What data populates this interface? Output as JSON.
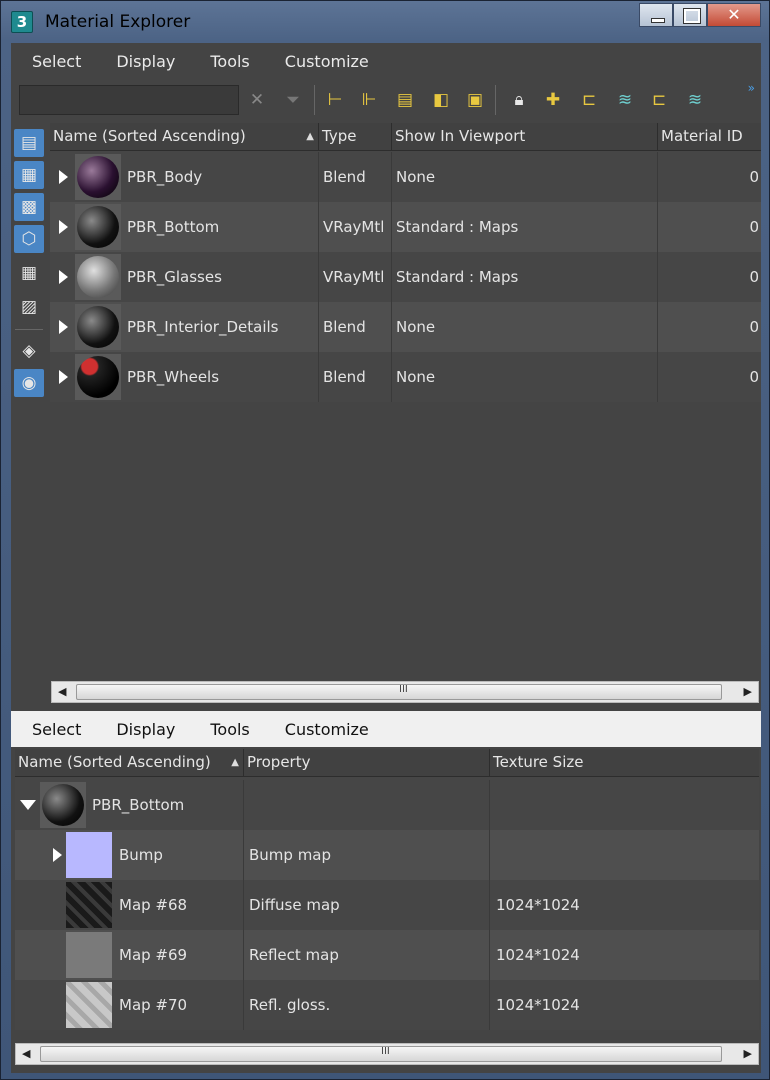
{
  "window": {
    "title": "Material Explorer",
    "app_icon_label": "3"
  },
  "top_menu": [
    "Select",
    "Display",
    "Tools",
    "Customize"
  ],
  "bottom_menu": [
    "Select",
    "Display",
    "Tools",
    "Customize"
  ],
  "search": {
    "value": "",
    "placeholder": ""
  },
  "toolbar_more": "»",
  "top_grid": {
    "columns": [
      "Name (Sorted Ascending)",
      "Type",
      "Show In Viewport",
      "Material ID"
    ],
    "rows": [
      {
        "name": "PBR_Body",
        "type": "Blend",
        "viewport": "None",
        "id": "0"
      },
      {
        "name": "PBR_Bottom",
        "type": "VRayMtl",
        "viewport": "Standard : Maps",
        "id": "0"
      },
      {
        "name": "PBR_Glasses",
        "type": "VRayMtl",
        "viewport": "Standard : Maps",
        "id": "0"
      },
      {
        "name": "PBR_Interior_Details",
        "type": "Blend",
        "viewport": "None",
        "id": "0"
      },
      {
        "name": "PBR_Wheels",
        "type": "Blend",
        "viewport": "None",
        "id": "0"
      }
    ]
  },
  "bottom_grid": {
    "columns": [
      "Name (Sorted Ascending)",
      "Property",
      "Texture Size"
    ],
    "root": {
      "name": "PBR_Bottom"
    },
    "rows": [
      {
        "name": "Bump",
        "property": "Bump map",
        "size": ""
      },
      {
        "name": "Map #68",
        "property": "Diffuse map",
        "size": "1024*1024"
      },
      {
        "name": "Map #69",
        "property": "Reflect map",
        "size": "1024*1024"
      },
      {
        "name": "Map #70",
        "property": "Refl. gloss.",
        "size": "1024*1024"
      }
    ]
  },
  "scroll_grip": "III",
  "colors": {
    "accent": "#4a86c5",
    "panel": "#444444",
    "title_gradient_top": "#5d7496"
  }
}
